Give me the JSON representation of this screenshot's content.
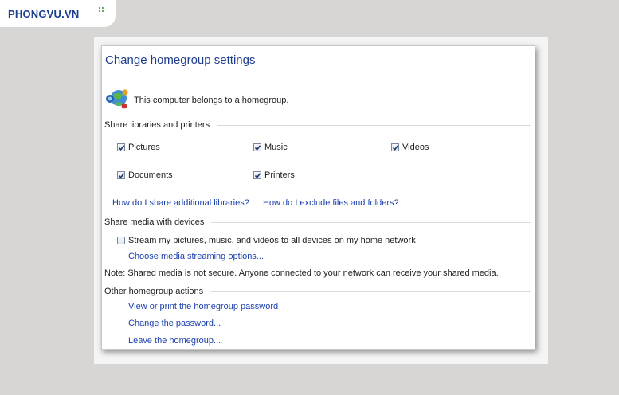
{
  "watermark": {
    "brand": "PHONGVU.VN"
  },
  "page": {
    "title": "Change homegroup settings",
    "status": "This computer belongs to a homegroup."
  },
  "share_libraries": {
    "heading": "Share libraries and printers",
    "items": [
      {
        "label": "Pictures",
        "checked": true
      },
      {
        "label": "Music",
        "checked": true
      },
      {
        "label": "Videos",
        "checked": true
      },
      {
        "label": "Documents",
        "checked": true
      },
      {
        "label": "Printers",
        "checked": true
      }
    ],
    "link_additional": "How do I share additional libraries?",
    "link_exclude": "How do I exclude files and folders?"
  },
  "share_media": {
    "heading": "Share media with devices",
    "stream_label": "Stream my pictures, music, and videos to all devices on my home network",
    "stream_checked": false,
    "link_options": "Choose media streaming options...",
    "note": "Note: Shared media is not secure. Anyone connected to your network can receive your shared media."
  },
  "other_actions": {
    "heading": "Other homegroup actions",
    "links": [
      "View or print the homegroup password",
      "Change the password...",
      "Leave the homegroup..."
    ]
  },
  "colors": {
    "title": "#1e3d8c",
    "link": "#1a3fae",
    "background": "#d8d6d4"
  }
}
